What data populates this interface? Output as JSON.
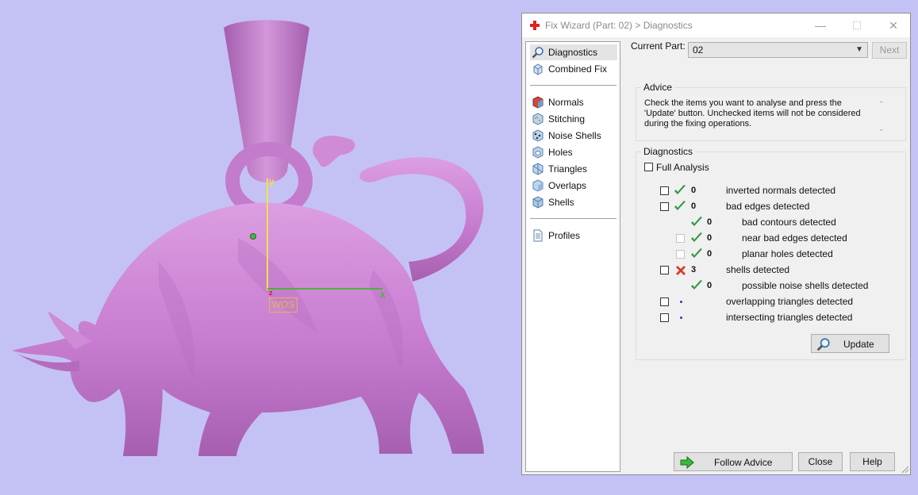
{
  "viewport": {
    "axis_y": "y",
    "axis_x": "x",
    "axis_z": "z",
    "wos_label": "WOS",
    "model_color": "#cc82d4",
    "background_color": "#c4c2f4"
  },
  "window": {
    "title": "Fix Wizard (Part: 02) > Diagnostics",
    "minimize": "—",
    "maximize": "☐",
    "close": "✕"
  },
  "sidebar": {
    "items": [
      {
        "label": "Diagnostics",
        "icon": "magnifier-icon"
      },
      {
        "label": "Combined Fix",
        "icon": "cube-icon"
      },
      {
        "label": "Normals",
        "icon": "normals-icon"
      },
      {
        "label": "Stitching",
        "icon": "stitching-icon"
      },
      {
        "label": "Noise Shells",
        "icon": "noise-shells-icon"
      },
      {
        "label": "Holes",
        "icon": "holes-icon"
      },
      {
        "label": "Triangles",
        "icon": "triangles-icon"
      },
      {
        "label": "Overlaps",
        "icon": "overlaps-icon"
      },
      {
        "label": "Shells",
        "icon": "shells-icon"
      },
      {
        "label": "Profiles",
        "icon": "document-icon"
      }
    ]
  },
  "header": {
    "current_part_label": "Current Part:",
    "current_part_value": "02",
    "next_label": "Next"
  },
  "advice": {
    "title": "Advice",
    "text": "Check the items you want to analyse and press the 'Update' button. Unchecked items will not be considered during the fixing operations."
  },
  "diagnostics": {
    "title": "Diagnostics",
    "full_analysis_label": "Full Analysis",
    "rows": [
      {
        "count": "0",
        "label": "inverted normals detected",
        "status": "ok"
      },
      {
        "count": "0",
        "label": "bad edges detected",
        "status": "ok"
      },
      {
        "count": "0",
        "label": "bad contours detected",
        "status": "ok"
      },
      {
        "count": "0",
        "label": "near bad edges detected",
        "status": "ok"
      },
      {
        "count": "0",
        "label": "planar holes detected",
        "status": "ok"
      },
      {
        "count": "3",
        "label": "shells detected",
        "status": "error"
      },
      {
        "count": "0",
        "label": "possible noise shells detected",
        "status": "ok"
      },
      {
        "count": "",
        "label": "overlapping triangles detected",
        "status": "pending"
      },
      {
        "count": "",
        "label": "intersecting triangles detected",
        "status": "pending"
      }
    ],
    "update_label": "Update"
  },
  "footer": {
    "follow_advice_label": "Follow Advice",
    "close_label": "Close",
    "help_label": "Help"
  },
  "colors": {
    "check_green": "#2f9a47",
    "error_red": "#d83a2a",
    "pending_dot": "#2a3aa8"
  }
}
